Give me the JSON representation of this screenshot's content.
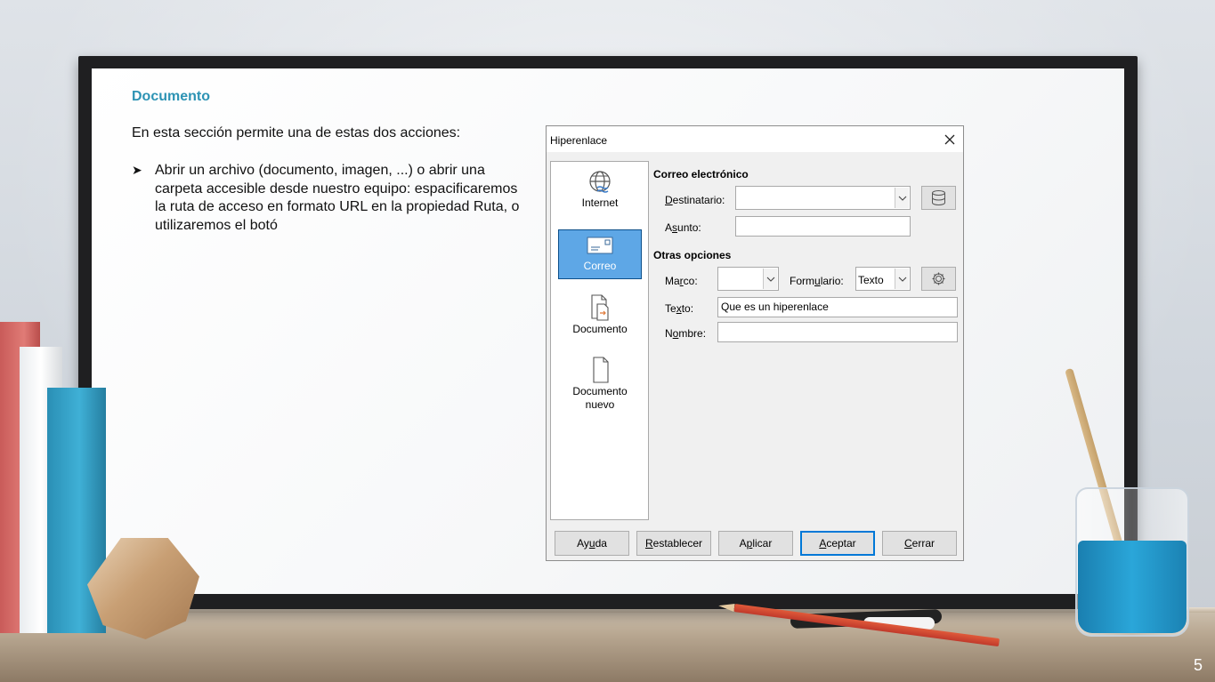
{
  "slide": {
    "title": "Documento",
    "intro": "En esta sección permite una de estas dos acciones:",
    "bullet": "Abrir un archivo (documento, imagen, ...) o abrir una carpeta accesible desde nuestro equipo: espacificaremos la ruta de acceso en formato URL en la propiedad Ruta, o utilizaremos el botó",
    "page_number": "5"
  },
  "dialog": {
    "title": "Hiperenlace",
    "nav": [
      {
        "label": "Internet",
        "icon": "globe-icon",
        "selected": false
      },
      {
        "label": "Correo",
        "icon": "mail-icon",
        "selected": true
      },
      {
        "label": "Documento",
        "icon": "document-icon",
        "selected": false
      },
      {
        "label": "Documento nuevo",
        "icon": "new-document-icon",
        "selected": false
      }
    ],
    "mail_section": {
      "title": "Correo electrónico",
      "recipient_label_ul": "D",
      "recipient_label_rest": "estinatario:",
      "recipient_value": "",
      "subject_label_a": "A",
      "subject_label_ul": "s",
      "subject_label_rest": "unto:",
      "subject_value": ""
    },
    "other_section": {
      "title": "Otras opciones",
      "frame_label_a": "Ma",
      "frame_label_ul": "r",
      "frame_label_rest": "co:",
      "frame_value": "",
      "form_label_a": "Form",
      "form_label_ul": "u",
      "form_label_rest": "lario:",
      "form_value": "Texto",
      "text_label_a": "Te",
      "text_label_ul": "x",
      "text_label_rest": "to:",
      "text_value": "Que es un hiperenlace",
      "name_label_a": "N",
      "name_label_ul": "o",
      "name_label_rest": "mbre:",
      "name_value": ""
    },
    "buttons": {
      "help_a": "Ay",
      "help_ul": "u",
      "help_rest": "da",
      "reset_ul": "R",
      "reset_rest": "establecer",
      "apply_a": "A",
      "apply_ul": "p",
      "apply_rest": "licar",
      "ok_ul": "A",
      "ok_rest": "ceptar",
      "close_ul": "C",
      "close_rest": "errar"
    }
  },
  "colors": {
    "title_accent": "#2d93b4",
    "selected_nav": "#5ea7e6",
    "default_button_border": "#0078d7"
  }
}
